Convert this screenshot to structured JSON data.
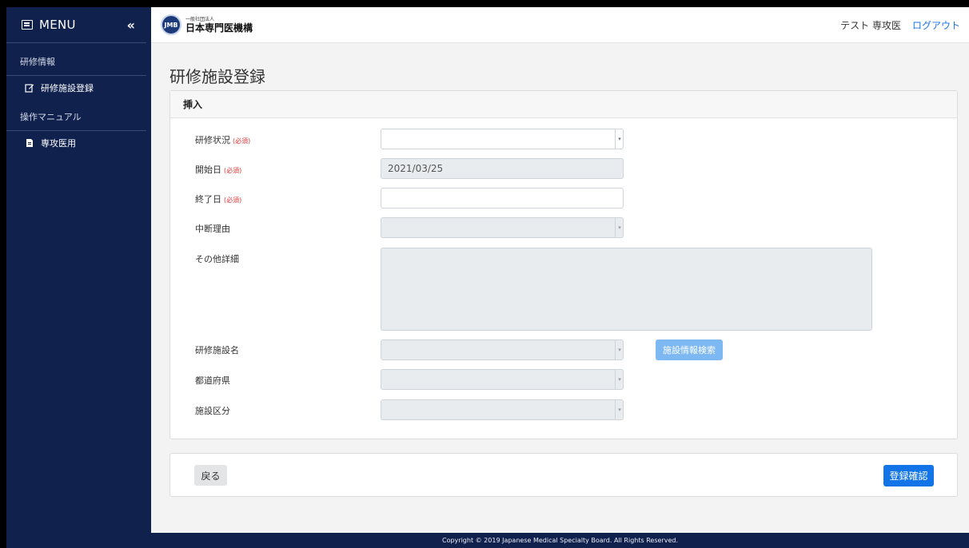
{
  "sidebar": {
    "menu_label": "MENU",
    "collapse_icon": "«",
    "sections": [
      {
        "title": "研修情報",
        "items": [
          {
            "label": "研修施設登録",
            "icon": "edit-icon"
          }
        ]
      },
      {
        "title": "操作マニュアル",
        "items": [
          {
            "label": "専攻医用",
            "icon": "document-icon"
          }
        ]
      }
    ]
  },
  "header": {
    "logo_sub": "一般社団法人",
    "logo_main": "日本専門医機構",
    "logo_mark": "JMB",
    "user_name": "テスト 専攻医",
    "logout": "ログアウト"
  },
  "page": {
    "title": "研修施設登録"
  },
  "form": {
    "card_title": "挿入",
    "required_mark": "(必須)",
    "fields": {
      "status": {
        "label": "研修状況",
        "value": ""
      },
      "start_date": {
        "label": "開始日",
        "value": "2021/03/25"
      },
      "end_date": {
        "label": "終了日",
        "value": ""
      },
      "interrupt_reason": {
        "label": "中断理由",
        "value": ""
      },
      "other_details": {
        "label": "その他詳細",
        "value": ""
      },
      "facility_name": {
        "label": "研修施設名",
        "value": ""
      },
      "prefecture": {
        "label": "都道府県",
        "value": ""
      },
      "facility_type": {
        "label": "施設区分",
        "value": ""
      }
    },
    "search_button": "施設情報検索"
  },
  "actions": {
    "back": "戻る",
    "confirm": "登録確認"
  },
  "footer": {
    "copyright": "Copyright © 2019 Japanese Medical Specialty Board. All Rights Reserved."
  },
  "colors": {
    "sidebar": "#10214e",
    "primary": "#1274e6",
    "link": "#1a73e8",
    "required": "#e03131"
  }
}
